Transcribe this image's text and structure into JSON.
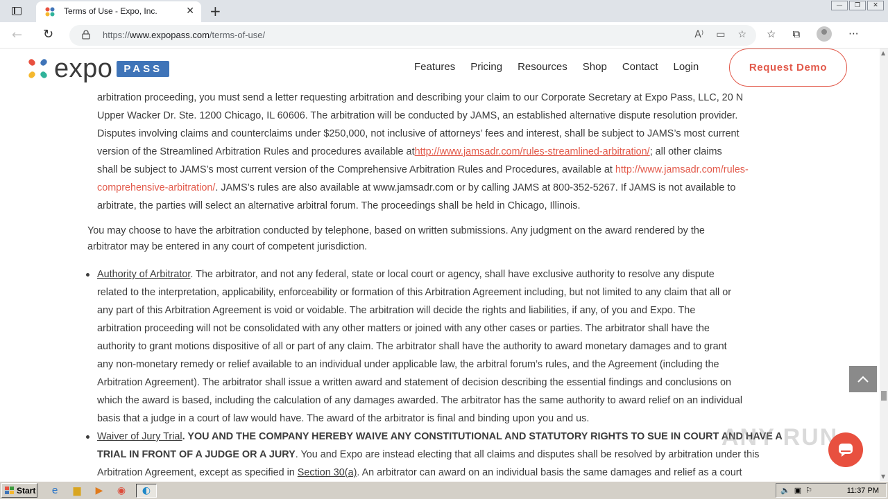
{
  "browser": {
    "tab_title": "Terms of Use - Expo, Inc.",
    "tab_close": "✕",
    "new_tab": "+",
    "url_prefix": "https://",
    "url_domain": "www.expopass.com",
    "url_path": "/terms-of-use/",
    "window_buttons": [
      "—",
      "❐",
      "✕"
    ]
  },
  "site": {
    "logo_text": "expo",
    "logo_badge": "PASS",
    "nav": [
      "Features",
      "Pricing",
      "Resources",
      "Shop",
      "Contact",
      "Login"
    ],
    "cta": "Request Demo"
  },
  "content": {
    "p1_line1": "arbitration proceeding, you must send a letter requesting arbitration and describing your claim to our Corporate Secretary at Expo Pass, LLC, 20 N",
    "p1_line2": "Upper Wacker Dr. Ste. 1200 Chicago, IL 60606. The arbitration will be conducted by JAMS, an established alternative dispute resolution provider.",
    "p1_line3": "Disputes involving claims and counterclaims under $250,000, not inclusive of attorneys’ fees and interest, shall be subject to JAMS’s most current",
    "p1_line4_a": "version of the Streamlined Arbitration Rules and procedures available at",
    "p1_line4_link": "http://www.jamsadr.com/rules-streamlined-arbitration/",
    "p1_line4_b": "; all other claims",
    "p1_line5_a": "shall be subject to JAMS’s most current version of the Comprehensive Arbitration Rules and Procedures, available at ",
    "p1_line5_link": "http://www.jamsadr.com/rules-",
    "p1_line6_link": "comprehensive-arbitration/",
    "p1_line6_b": ". JAMS’s rules are also available at www.jamsadr.com or by calling JAMS at 800-352-5267. If JAMS is not available to",
    "p1_line7": "arbitrate, the parties will select an alternative arbitral forum. The proceedings shall be held in Chicago, Illinois.",
    "p2_line1": "You may choose to have the arbitration conducted by telephone, based on written submissions. Any judgment on the award rendered by the",
    "p2_line2": "arbitrator may be entered in any court of competent jurisdiction.",
    "b1_heading": "Authority of Arbitrator",
    "b1_line1": ". The arbitrator, and not any federal, state or local court or agency, shall have exclusive authority to resolve any dispute",
    "b1_line2": "related to the interpretation, applicability, enforceability or formation of this Arbitration Agreement including, but not limited to any claim that all or",
    "b1_line3": "any part of this Arbitration Agreement is void or voidable. The arbitration will decide the rights and liabilities, if any, of you and Expo. The",
    "b1_line4": "arbitration proceeding will not be consolidated with any other matters or joined with any other cases or parties. The arbitrator shall have the",
    "b1_line5": "authority to grant motions dispositive of all or part of any claim. The arbitrator shall have the authority to award monetary damages and to grant",
    "b1_line6": "any non-monetary remedy or relief available to an individual under applicable law, the arbitral forum’s rules, and the Agreement (including the",
    "b1_line7": "Arbitration Agreement). The arbitrator shall issue a written award and statement of decision describing the essential findings and conclusions on",
    "b1_line8": "which the award is based, including the calculation of any damages awarded. The arbitrator has the same authority to award relief on an individual",
    "b1_line9": "basis that a judge in a court of law would have. The award of the arbitrator is final and binding upon you and us.",
    "b2_heading": "Waiver of Jury Trial",
    "b2_line1": ". YOU AND THE COMPANY HEREBY WAIVE ANY CONSTITUTIONAL AND STATUTORY RIGHTS TO SUE IN COURT AND HAVE A",
    "b2_line2_upper": "TRIAL IN FRONT OF A JUDGE OR A JURY",
    "b2_line2_b": ". You and Expo are instead electing that all claims and disputes shall be resolved by arbitration under this",
    "b2_line3_a": "Arbitration Agreement, except as specified in ",
    "b2_line3_link": "Section 30(a)",
    "b2_line3_b": ". An arbitrator can award on an individual basis the same damages and relief as a court"
  },
  "overlay": {
    "watermark": "ANY RUN"
  },
  "taskbar": {
    "start": "Start",
    "clock": "11:37 PM"
  },
  "colors": {
    "accent": "#e25a4b",
    "logo_blue": "#3f74b8"
  }
}
